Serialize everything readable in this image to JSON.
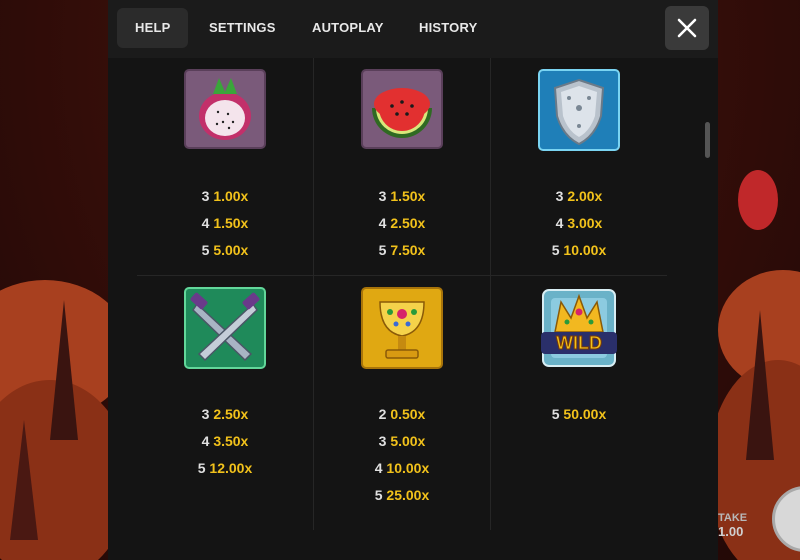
{
  "tabs": [
    {
      "label": "HELP",
      "active": true
    },
    {
      "label": "SETTINGS",
      "active": false
    },
    {
      "label": "AUTOPLAY",
      "active": false
    },
    {
      "label": "HISTORY",
      "active": false
    }
  ],
  "close_icon": "close-icon",
  "symbols": [
    {
      "name": "dragonfruit",
      "icon": "dragonfruit-icon",
      "pays": [
        {
          "count": "3",
          "mult": "1.00x"
        },
        {
          "count": "4",
          "mult": "1.50x"
        },
        {
          "count": "5",
          "mult": "5.00x"
        }
      ]
    },
    {
      "name": "watermelon",
      "icon": "watermelon-icon",
      "pays": [
        {
          "count": "3",
          "mult": "1.50x"
        },
        {
          "count": "4",
          "mult": "2.50x"
        },
        {
          "count": "5",
          "mult": "7.50x"
        }
      ]
    },
    {
      "name": "shield",
      "icon": "shield-icon",
      "pays": [
        {
          "count": "3",
          "mult": "2.00x"
        },
        {
          "count": "4",
          "mult": "3.00x"
        },
        {
          "count": "5",
          "mult": "10.00x"
        }
      ]
    },
    {
      "name": "swords",
      "icon": "crossed-swords-icon",
      "pays": [
        {
          "count": "3",
          "mult": "2.50x"
        },
        {
          "count": "4",
          "mult": "3.50x"
        },
        {
          "count": "5",
          "mult": "12.00x"
        }
      ]
    },
    {
      "name": "chalice",
      "icon": "golden-chalice-icon",
      "pays": [
        {
          "count": "2",
          "mult": "0.50x"
        },
        {
          "count": "3",
          "mult": "5.00x"
        },
        {
          "count": "4",
          "mult": "10.00x"
        },
        {
          "count": "5",
          "mult": "25.00x"
        }
      ]
    },
    {
      "name": "wild",
      "icon": "wild-crown-icon",
      "label": "WILD",
      "pays": [
        {
          "count": "5",
          "mult": "50.00x"
        }
      ]
    }
  ],
  "background": {
    "take_label": "TAKE",
    "stake_value": "1.00"
  },
  "colors": {
    "accent": "#f2c21b",
    "panel": "#141414",
    "tabbar": "#1b1b1b",
    "active_tab": "#2b2b2b",
    "close_bg": "#3a3a3a"
  }
}
